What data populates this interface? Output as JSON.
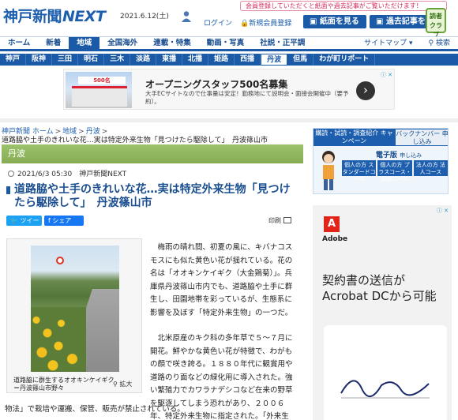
{
  "header": {
    "logo_main": "神戸新聞",
    "logo_next": "NEXT",
    "date": "2021.6.12(土)",
    "login": "ログイン",
    "new_reg": "新規会員登録",
    "notice": "会員登録していただくと紙面や過去記事がご覧いただけます！",
    "btn_paper": "紙面を見る",
    "btn_past": "過去記事を見る",
    "reader_club": "読者クラブ"
  },
  "nav_main": {
    "items": [
      "ホーム",
      "新着",
      "地域",
      "全国海外",
      "連載・特集",
      "動画・写真",
      "社説・正平調"
    ],
    "active_index": 2,
    "sitemap": "サイトマップ",
    "search": "検索"
  },
  "nav_region": {
    "items": [
      "神戸",
      "阪神",
      "三田",
      "明石",
      "三木",
      "淡路",
      "東播",
      "北播",
      "姫路",
      "西播",
      "丹波",
      "但馬",
      "わが町リポート"
    ],
    "active_index": 10
  },
  "ad_banner": {
    "image_text": "500名",
    "title": "オープニングスタッフ500名募集",
    "text": "大手ECサイトなので仕事量は安定！勤務地にて説明会・面接会開催中（要予約）。",
    "arrow": "›",
    "badges": "ⓘ ✕"
  },
  "breadcrumb": {
    "items": [
      "神戸新聞 ホーム",
      "地域",
      "丹波"
    ],
    "separator": ">",
    "current": "道路脇や土手のきれいな花…実は特定外来生物「見つけたら駆除して」　丹波篠山市"
  },
  "section_label": "丹波",
  "article": {
    "datetime": "2021/6/3 05:30",
    "source": "神戸新聞NEXT",
    "headline": "道路脇や土手のきれいな花…実は特定外来生物「見つけたら駆除して」　丹波篠山市",
    "tweet": "ツイート",
    "fb": "シェア",
    "print": "印刷",
    "photo_caption": "道路脇に群生するオオキンケイギク＝丹波篠山市野々",
    "zoom": "拡大",
    "paragraphs": [
      "梅雨の晴れ間、初夏の風に、キバナコスモスにも似た黄色い花が揺れている。花の名は「オオキンケイギク（大金鶏菊）」。兵庫県丹波篠山市内でも、道路脇や土手に群生し、田園地帯を彩っているが、生態系に影響を及ぼす「特定外来生物」の一つだ。",
      "北米原産のキク科の多年草で５～７月に開花。鮮やかな黄色い花が特徴で、わがもの顔で咲き誇る。１８８０年代に観賞用や道路のり面などの緑化用に導入された。強い繁殖力でカワラナデシコなど在来の野草を駆逐してしまう恐れがあり、２００６年、特定外来生物に指定された。「外来生"
    ],
    "last_line": "物法」で栽培や運搬、保管、販売が禁止されている。"
  },
  "sidebar": {
    "promo": {
      "top": "購読・試読・調査紹介 キャンペーン",
      "back": "バックナンバー 申し込み",
      "denshi": "電子版",
      "denshi_sub": "申し込み",
      "buttons": [
        "個人の方 スタンダードコース",
        "個人の方 プラスコース・同紙コース",
        "法人の方 法人コース"
      ]
    },
    "adobe": {
      "logo": "A",
      "brand": "Adobe",
      "line1": "契約書の送信が",
      "line2": "Acrobat DCから可能",
      "adchoice": "ⓘ ✕"
    }
  }
}
